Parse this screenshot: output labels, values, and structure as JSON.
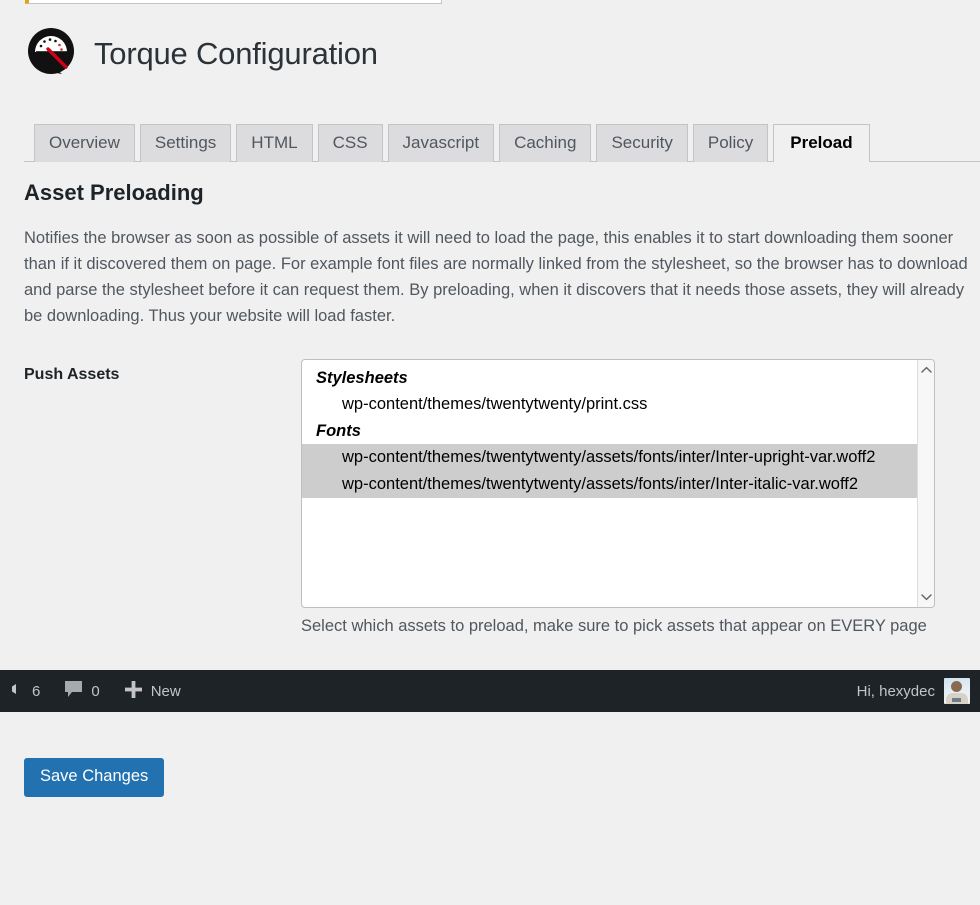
{
  "header": {
    "title": "Torque Configuration",
    "logo_icon": "speedometer-gauge-icon"
  },
  "tabs": [
    {
      "label": "Overview",
      "active": false
    },
    {
      "label": "Settings",
      "active": false
    },
    {
      "label": "HTML",
      "active": false
    },
    {
      "label": "CSS",
      "active": false
    },
    {
      "label": "Javascript",
      "active": false
    },
    {
      "label": "Caching",
      "active": false
    },
    {
      "label": "Security",
      "active": false
    },
    {
      "label": "Policy",
      "active": false
    },
    {
      "label": "Preload",
      "active": true
    }
  ],
  "section": {
    "title": "Asset Preloading",
    "description": "Notifies the browser as soon as possible of assets it will need to load the page, this enables it to start downloading them sooner than if it discovered them on page. For example font files are normally linked from the stylesheet, so the browser has to download and parse the stylesheet before it can request them. By preloading, when it discovers that it needs those assets, they will already be downloading. Thus your website will load faster."
  },
  "push_assets": {
    "label": "Push Assets",
    "help_text": "Select which assets to preload, make sure to pick assets that appear on EVERY page",
    "groups": [
      {
        "label": "Stylesheets",
        "options": [
          {
            "value": "wp-content/themes/twentytwenty/print.css",
            "selected": false
          }
        ]
      },
      {
        "label": "Fonts",
        "options": [
          {
            "value": "wp-content/themes/twentytwenty/assets/fonts/inter/Inter-upright-var.woff2",
            "selected": true
          },
          {
            "value": "wp-content/themes/twentytwenty/assets/fonts/inter/Inter-italic-var.woff2",
            "selected": true
          }
        ]
      }
    ]
  },
  "admin_bar": {
    "updates_count": "6",
    "comments_count": "0",
    "new_label": "New",
    "greeting": "Hi, hexydec"
  },
  "footer": {
    "save_label": "Save Changes"
  },
  "colors": {
    "page_background": "#f0f0f1",
    "admin_bar_background": "#1d2327",
    "primary_button": "#2271b1",
    "tab_background": "#dcdcde",
    "selection_highlight": "#cdcdcd",
    "notice_accent": "#dba617"
  }
}
